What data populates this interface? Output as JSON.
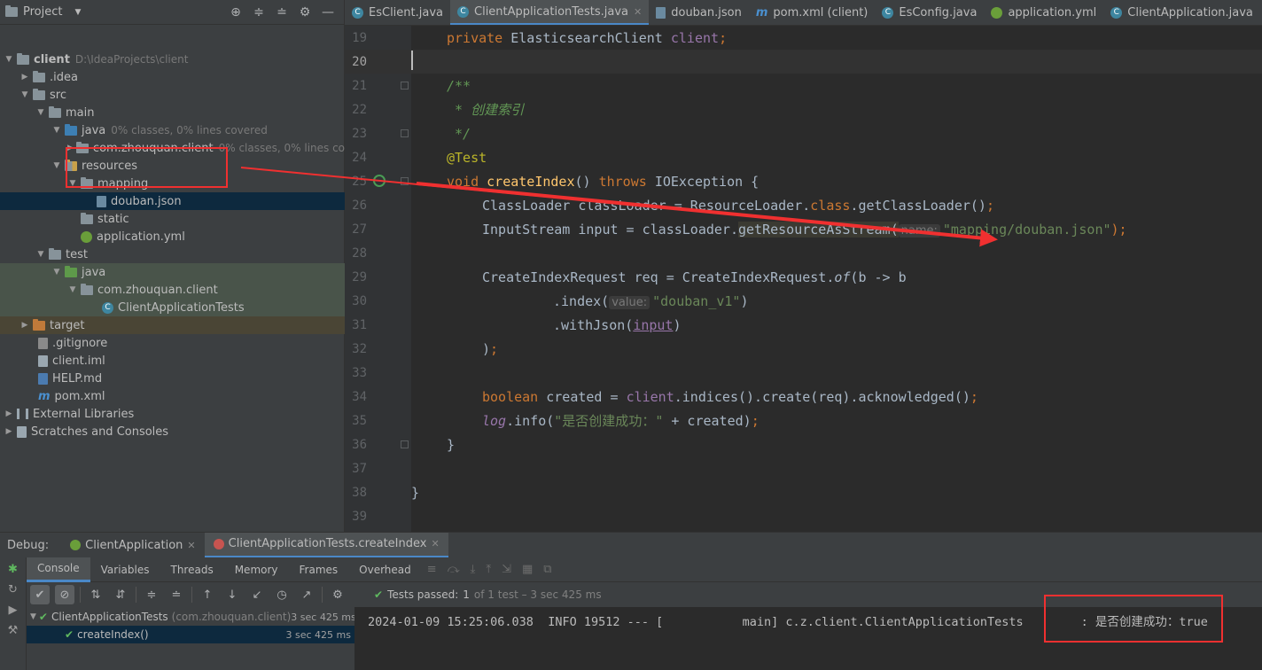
{
  "project": {
    "title": "Project",
    "tree": [
      {
        "label": "client",
        "hint": "D:\\IdeaProjects\\client",
        "icon": "folder-icon"
      },
      {
        "label": ".idea",
        "icon": "folder-icon"
      },
      {
        "label": "src",
        "icon": "folder-icon"
      },
      {
        "label": "main",
        "icon": "folder-icon"
      },
      {
        "label": "java",
        "hint": "0% classes, 0% lines covered",
        "icon": "source-folder-icon"
      },
      {
        "label": "com.zhouquan.client",
        "hint": "0% classes, 0% lines covered",
        "icon": "package-icon"
      },
      {
        "label": "resources",
        "icon": "resources-folder-icon"
      },
      {
        "label": "mapping",
        "icon": "folder-icon"
      },
      {
        "label": "douban.json",
        "icon": "json-file-icon"
      },
      {
        "label": "static",
        "icon": "folder-icon"
      },
      {
        "label": "application.yml",
        "icon": "spring-yml-icon"
      },
      {
        "label": "test",
        "icon": "folder-icon"
      },
      {
        "label": "java",
        "icon": "test-folder-icon"
      },
      {
        "label": "com.zhouquan.client",
        "icon": "package-icon"
      },
      {
        "label": "ClientApplicationTests",
        "icon": "class-icon"
      },
      {
        "label": "target",
        "icon": "excluded-folder-icon"
      },
      {
        "label": ".gitignore",
        "icon": "git-file-icon"
      },
      {
        "label": "client.iml",
        "icon": "iml-file-icon"
      },
      {
        "label": "HELP.md",
        "icon": "markdown-file-icon"
      },
      {
        "label": "pom.xml",
        "icon": "maven-icon"
      },
      {
        "label": "External Libraries",
        "icon": "library-icon"
      },
      {
        "label": "Scratches and Consoles",
        "icon": "scratches-icon"
      }
    ]
  },
  "tabs": [
    {
      "label": "EsClient.java",
      "icon": "class-icon"
    },
    {
      "label": "ClientApplicationTests.java",
      "icon": "class-icon"
    },
    {
      "label": "douban.json",
      "icon": "json-file-icon"
    },
    {
      "label": "pom.xml (client)",
      "icon": "maven-icon"
    },
    {
      "label": "EsConfig.java",
      "icon": "class-icon"
    },
    {
      "label": "application.yml",
      "icon": "spring-yml-icon"
    },
    {
      "label": "ClientApplication.java",
      "icon": "class-icon"
    }
  ],
  "editor": {
    "line_numbers": [
      "19",
      "20",
      "21",
      "22",
      "23",
      "24",
      "25",
      "26",
      "27",
      "28",
      "29",
      "30",
      "31",
      "32",
      "33",
      "34",
      "35",
      "36",
      "37",
      "38",
      "39"
    ],
    "current_line": "20",
    "hints": {
      "name": "name:",
      "value": "value:"
    },
    "code": {
      "l19_kw": "private ",
      "l19_type": "ElasticsearchClient ",
      "l19_field": "client",
      "l19_end": ";",
      "l21": "/**",
      "l22": " * 创建索引",
      "l23": " */",
      "l24": "@Test",
      "l25_kw": "void ",
      "l25_fn": "createIndex",
      "l25_mid": "() ",
      "l25_throws": "throws ",
      "l25_end": "IOException {",
      "l26_a": "ClassLoader classLoader = ResourceLoader.",
      "l26_kw": "class",
      "l26_b": ".getClassLoader()",
      "l26_end": ";",
      "l27_a": "InputStream input = classLoader.",
      "l27_hl": "getResourceAsStream(",
      "l27_str": "\"mapping/douban.json\"",
      "l27_end": ");",
      "l29_a": "CreateIndexRequest req = CreateIndexRequest.",
      "l29_of": "of",
      "l29_b": "(b -> b",
      "l30_a": ".index(",
      "l30_str": "\"douban_v1\"",
      "l30_b": ")",
      "l31_a": ".withJson(",
      "l31_var": "input",
      "l31_b": ")",
      "l32_a": ")",
      "l32_end": ";",
      "l34_kw": "boolean ",
      "l34_a": "created = ",
      "l34_field": "client",
      "l34_b": ".indices().create(req).acknowledged()",
      "l34_end": ";",
      "l35_log": "log",
      "l35_a": ".info(",
      "l35_str": "\"是否创建成功：\"",
      "l35_b": " + created)",
      "l35_end": ";",
      "l36": "}",
      "l38": "}"
    }
  },
  "debug": {
    "label": "Debug:",
    "sessions": [
      {
        "label": "ClientApplication"
      },
      {
        "label": "ClientApplicationTests.createIndex"
      }
    ],
    "subtabs": [
      "Console",
      "Variables",
      "Threads",
      "Memory",
      "Frames",
      "Overhead"
    ],
    "status": {
      "prefix": "Tests passed:",
      "count": "1",
      "rest": "of 1 test – 3 sec 425 ms"
    },
    "test_tree": [
      {
        "label": "ClientApplicationTests",
        "sub": "(com.zhouquan.client)",
        "time": "3 sec 425 ms"
      },
      {
        "label": "createIndex()",
        "time": "3 sec 425 ms"
      }
    ],
    "log_line": "2024-01-09 15:25:06.038  INFO 19512 --- [           main] c.z.client.ClientApplicationTests        : 是否创建成功：true"
  },
  "colors": {
    "annotation_red": "#f03030",
    "accent": "#4a88c7",
    "pass_green": "#5fb85f"
  }
}
